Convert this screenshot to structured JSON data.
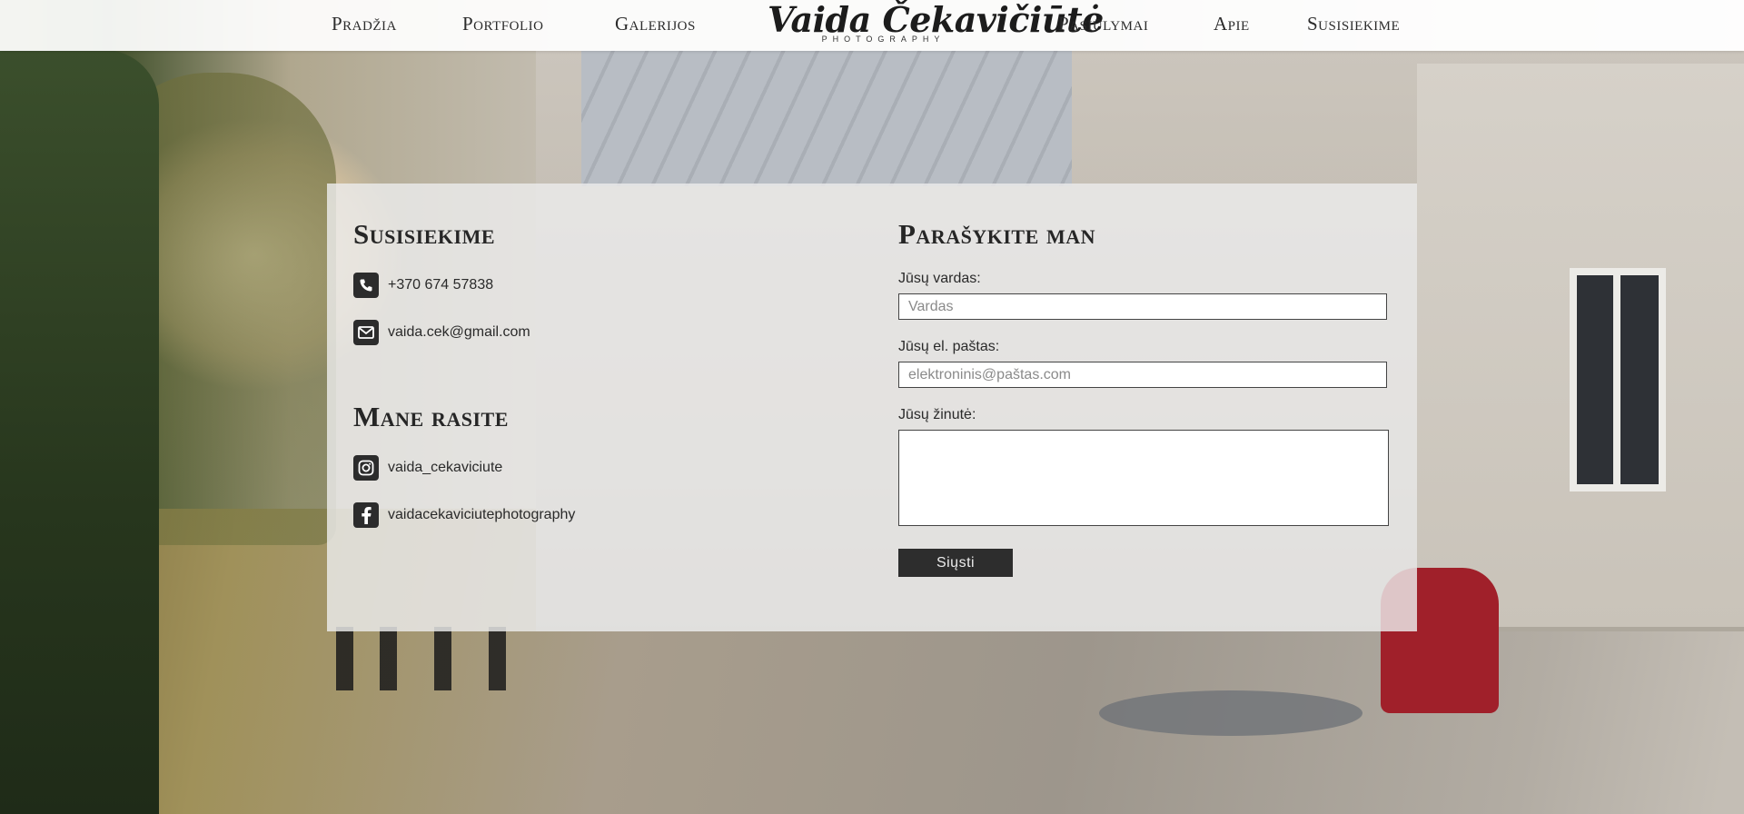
{
  "nav": {
    "items": [
      "Pradžia",
      "Portfolio",
      "Galerijos",
      "Pasiūlymai",
      "Apie",
      "Susisiekime"
    ],
    "logo_name": "Vaida Čekavičiūtė",
    "logo_sub": "PHOTOGRAPHY"
  },
  "contact": {
    "heading": "Susisiekime",
    "phone": "+370 674 57838",
    "email": "vaida.cek@gmail.com"
  },
  "social": {
    "heading": "Mane rasite",
    "instagram": "vaida_cekaviciute",
    "facebook": "vaidacekaviciutephotography"
  },
  "form": {
    "heading": "Parašykite man",
    "name_label": "Jūsų vardas:",
    "name_placeholder": "Vardas",
    "email_label": "Jūsų el. paštas:",
    "email_placeholder": "elektroninis@paštas.com",
    "message_label": "Jūsų žinutė:",
    "submit_label": "Siųsti"
  },
  "icons": {
    "phone": "phone-icon",
    "email": "envelope-icon",
    "instagram": "instagram-icon",
    "facebook": "facebook-icon"
  }
}
